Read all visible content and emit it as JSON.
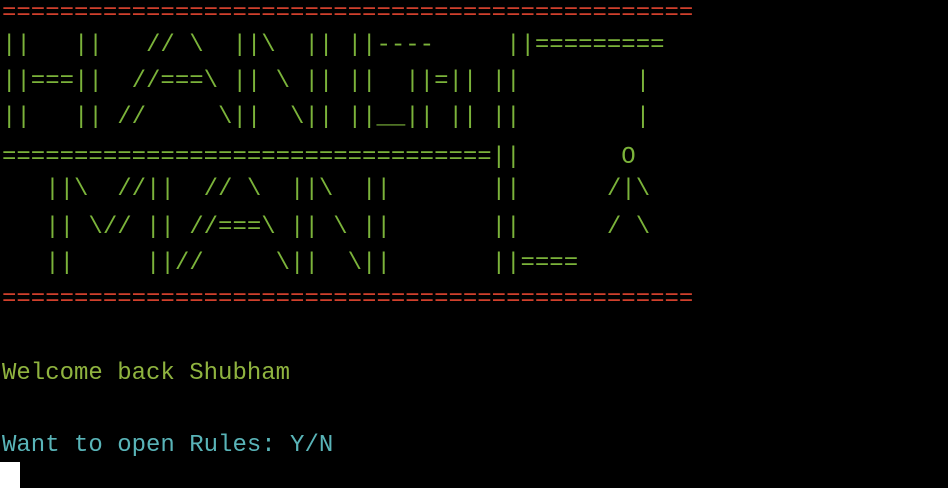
{
  "terminal": {
    "banner_top": "================================================",
    "art": [
      "||   ||   // \\  ||\\  || ||----     ||=========",
      "||===||  //===\\ || \\ || ||  ||=|| ||        |",
      "||   || //     \\||  \\|| ||__|| || ||        |",
      "==================================||       O",
      "   ||\\  //||  // \\  ||\\  ||       ||      /|\\",
      "   || \\// || //===\\ || \\ ||       ||      / \\",
      "   ||     ||//     \\||  \\||       ||===="
    ],
    "banner_bottom": "================================================",
    "welcome_text": "Welcome back Shubham",
    "prompt_text": "Want to open Rules: Y/N"
  },
  "colors": {
    "banner": "#d0402c",
    "art": "#7bb33a",
    "welcome": "#8fb33f",
    "prompt": "#59b4b8",
    "cursor": "#ffffff",
    "background": "#000000"
  }
}
